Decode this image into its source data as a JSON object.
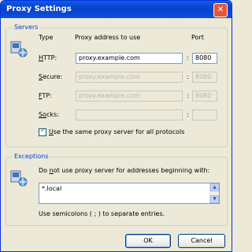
{
  "window": {
    "title": "Proxy Settings",
    "close_glyph": "✕"
  },
  "servers": {
    "label": "Servers",
    "col_type": "Type",
    "col_address": "Proxy address to use",
    "col_port": "Port",
    "rows": [
      {
        "label_u": "H",
        "label_rest": "TTP:",
        "address": "proxy.example.com",
        "port": "8080",
        "enabled": true
      },
      {
        "label_u": "S",
        "label_rest": "ecure:",
        "address": "proxy.example.com",
        "port": "8080",
        "enabled": false
      },
      {
        "label_u": "F",
        "label_rest": "TP:",
        "address": "proxy.example.com",
        "port": "8080",
        "enabled": false
      },
      {
        "label_u": "So",
        "label_rest": "cks:",
        "address": "",
        "port": "",
        "enabled": false
      }
    ],
    "colon": ":",
    "same_proxy": {
      "label_u": "U",
      "label_rest": "se the same proxy server for all protocols",
      "checked": true,
      "check_glyph": "✓"
    }
  },
  "exceptions": {
    "label": "Exceptions",
    "desc_pre": "Do ",
    "desc_u": "n",
    "desc_rest": "ot use proxy server for addresses beginning with:",
    "value": "*.local",
    "hint": "Use semicolons ( ; ) to separate entries.",
    "scroll_up": "▲",
    "scroll_down": "▼"
  },
  "buttons": {
    "ok": "OK",
    "cancel": "Cancel"
  },
  "icons": {
    "window": "network-computer-icon"
  },
  "colors": {
    "title_bar": "#0a5fe8",
    "group_label": "#0046d5",
    "face": "#ece9d8"
  }
}
